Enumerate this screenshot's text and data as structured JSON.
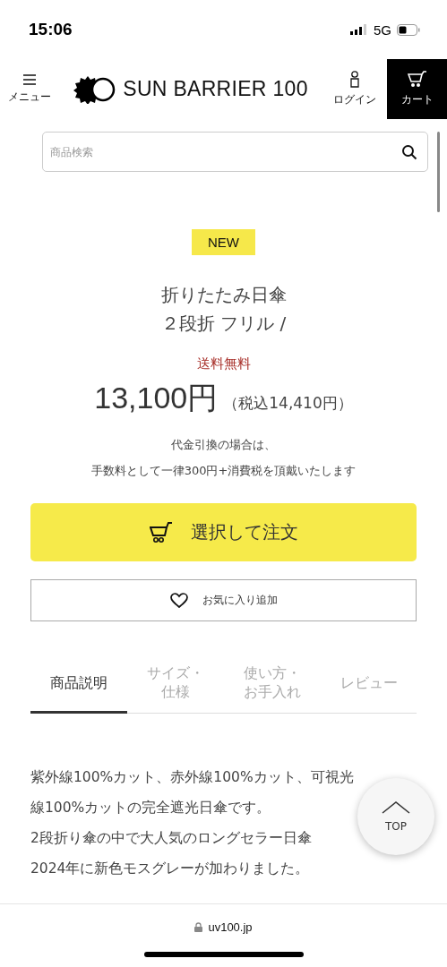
{
  "status_bar": {
    "time": "15:06",
    "network": "5G"
  },
  "header": {
    "menu_label": "メニュー",
    "brand": "SUN BARRIER 100",
    "login_label": "ログイン",
    "cart_label": "カート"
  },
  "search": {
    "placeholder": "商品検索"
  },
  "product": {
    "badge": "NEW",
    "title_lines": [
      "折りたたみ日傘",
      "２段折 フリル /"
    ],
    "shipping": "送料無料",
    "price": "13,100円",
    "price_tax": "（税込14,410円）",
    "note_lines": [
      "代金引換の場合は、",
      "手数料として一律300円+消費税を頂戴いたします"
    ]
  },
  "buttons": {
    "order": "選択して注文",
    "favorite": "お気に入り追加"
  },
  "tabs": [
    {
      "label": "商品説明",
      "selected": true
    },
    {
      "label": "サイズ・仕様",
      "selected": false
    },
    {
      "label": "使い方・お手入れ",
      "selected": false
    },
    {
      "label": "レビュー",
      "selected": false
    }
  ],
  "description_lines": [
    "紫外線100%カット、赤外線100%カット、可視光",
    "線100%カットの完全遮光日傘です。",
    "2段折り傘の中で大人気のロングセラー日傘",
    "2024年に新色モスグレーが加わりました。"
  ],
  "top_button": {
    "label": "TOP"
  },
  "browser_bar": {
    "url": "uv100.jp"
  }
}
